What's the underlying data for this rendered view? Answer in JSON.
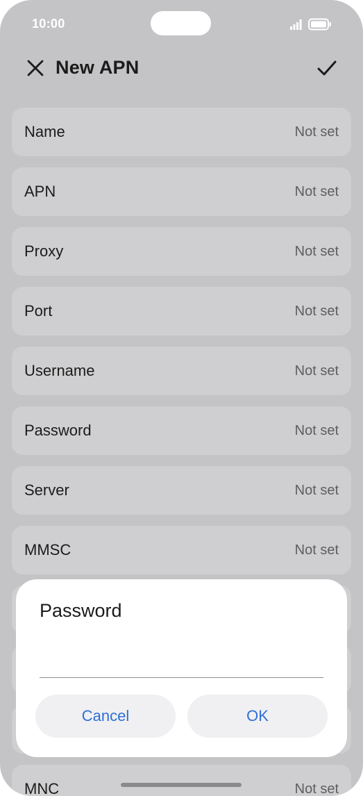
{
  "status_bar": {
    "time": "10:00"
  },
  "header": {
    "title": "New APN"
  },
  "fields": [
    {
      "label": "Name",
      "value": "Not set"
    },
    {
      "label": "APN",
      "value": "Not set"
    },
    {
      "label": "Proxy",
      "value": "Not set"
    },
    {
      "label": "Port",
      "value": "Not set"
    },
    {
      "label": "Username",
      "value": "Not set"
    },
    {
      "label": "Password",
      "value": "Not set"
    },
    {
      "label": "Server",
      "value": "Not set"
    },
    {
      "label": "MMSC",
      "value": "Not set"
    },
    {
      "label": "",
      "value": ""
    },
    {
      "label": "",
      "value": ""
    },
    {
      "label": "",
      "value": ""
    },
    {
      "label": "MNC",
      "value": "Not set"
    }
  ],
  "dialog": {
    "title": "Password",
    "input_value": "",
    "cancel_label": "Cancel",
    "ok_label": "OK"
  },
  "colors": {
    "accent": "#2f6fd6",
    "scrim_background": "#c4c4c6",
    "row_background": "#cfcfd1"
  },
  "icons": {
    "close": "close-icon",
    "confirm": "check-icon",
    "signal": "signal-icon",
    "battery": "battery-icon"
  }
}
